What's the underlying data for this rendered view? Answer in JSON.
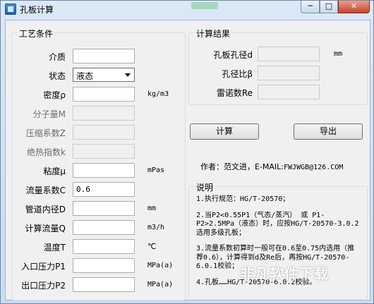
{
  "window": {
    "title": "孔板计算",
    "min_glyph": "─",
    "max_glyph": "□",
    "close_glyph": "✕"
  },
  "left_group": {
    "title": "工艺条件",
    "fields": [
      {
        "label": "介质",
        "value": "",
        "unit": "",
        "enabled": true
      },
      {
        "label": "状态",
        "value": "液态",
        "unit": "",
        "enabled": true,
        "type": "select"
      },
      {
        "label": "密度ρ",
        "value": "",
        "unit": "kg/m3",
        "enabled": true
      },
      {
        "label": "分子量M",
        "value": "",
        "unit": "",
        "enabled": false
      },
      {
        "label": "压缩系数Z",
        "value": "",
        "unit": "",
        "enabled": false
      },
      {
        "label": "绝热指数k",
        "value": "",
        "unit": "",
        "enabled": false
      },
      {
        "label": "粘度μ",
        "value": "",
        "unit": "mPas",
        "enabled": true
      },
      {
        "label": "流量系数C",
        "value": "0.6",
        "unit": "",
        "enabled": true
      },
      {
        "label": "管道内径D",
        "value": "",
        "unit": "mm",
        "enabled": true
      },
      {
        "label": "计算流量Q",
        "value": "",
        "unit": "m3/h",
        "enabled": true
      },
      {
        "label": "温度T",
        "value": "",
        "unit": "℃",
        "enabled": true
      },
      {
        "label": "入口压力P1",
        "value": "",
        "unit": "MPa(a)",
        "enabled": true
      },
      {
        "label": "出口压力P2",
        "value": "",
        "unit": "MPa(a)",
        "enabled": true
      }
    ]
  },
  "right_group": {
    "title": "计算结果",
    "results": [
      {
        "label": "孔板孔径d",
        "value": "",
        "unit": "mm"
      },
      {
        "label": "孔径比β",
        "value": "",
        "unit": ""
      },
      {
        "label": "雷诺数Re",
        "value": "",
        "unit": ""
      }
    ]
  },
  "buttons": {
    "calculate": "计算",
    "export": "导出"
  },
  "author": {
    "prefix": "作者：范文进，E-MAIL:",
    "email": "FWJWGB@126.COM"
  },
  "notes": {
    "title": "说明",
    "items": [
      "1.执行规范：HG/T-20570；",
      "2.当P2<0.55P1（气态/蒸汽） 或 P1-P2>2.5MPa（液态）时，应按HG/T-20570-3.0.2选用多级孔板；",
      "3.流量系数初算时一般可在0.6至0.75内选用（推荐0.6），计算得到d及Re后，再按HG/T-20570-6.0.1校验；",
      "4.孔板……HG/T-20570-6.0.2校验。"
    ]
  },
  "watermark": "非凡软件下载",
  "colors": {
    "title_bg": "#dbe8f6",
    "close_button": "#c7422a",
    "client_bg": "#f0f0f0"
  }
}
